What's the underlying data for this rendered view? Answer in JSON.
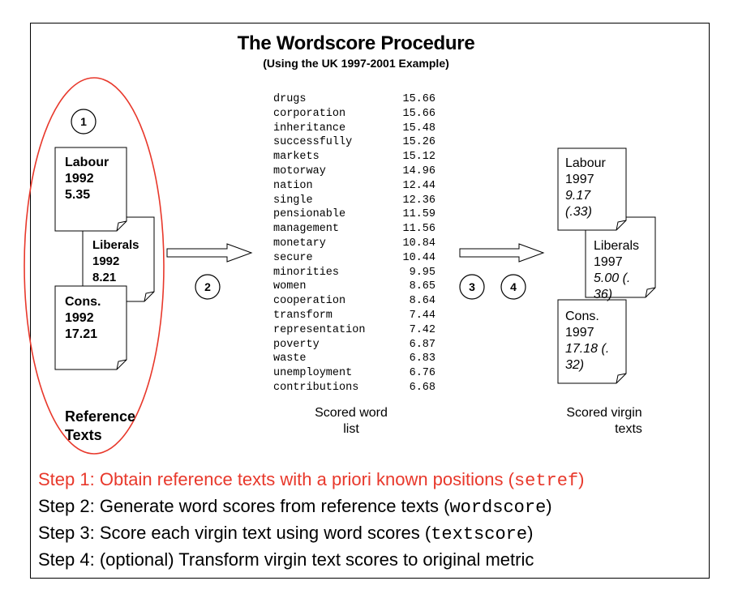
{
  "title": "The Wordscore Procedure",
  "subtitle": "(Using the UK 1997-2001 Example)",
  "reference": {
    "labour": {
      "name": "Labour",
      "year": "1992",
      "score": "5.35"
    },
    "liberals": {
      "name": "Liberals",
      "year": "1992",
      "score": "8.21"
    },
    "cons": {
      "name": "Cons.",
      "year": "1992",
      "score": "17.21"
    },
    "caption_line1": "Reference",
    "caption_line2": "Texts"
  },
  "word_list": [
    {
      "word": "drugs",
      "score": "15.66"
    },
    {
      "word": "corporation",
      "score": "15.66"
    },
    {
      "word": "inheritance",
      "score": "15.48"
    },
    {
      "word": "successfully",
      "score": "15.26"
    },
    {
      "word": "markets",
      "score": "15.12"
    },
    {
      "word": "motorway",
      "score": "14.96"
    },
    {
      "word": "nation",
      "score": "12.44"
    },
    {
      "word": "single",
      "score": "12.36"
    },
    {
      "word": "pensionable",
      "score": "11.59"
    },
    {
      "word": "management",
      "score": "11.56"
    },
    {
      "word": "monetary",
      "score": "10.84"
    },
    {
      "word": "secure",
      "score": "10.44"
    },
    {
      "word": "minorities",
      "score": "9.95"
    },
    {
      "word": "women",
      "score": "8.65"
    },
    {
      "word": "cooperation",
      "score": "8.64"
    },
    {
      "word": "transform",
      "score": "7.44"
    },
    {
      "word": "representation",
      "score": "7.42"
    },
    {
      "word": "poverty",
      "score": "6.87"
    },
    {
      "word": "waste",
      "score": "6.83"
    },
    {
      "word": "unemployment",
      "score": "6.76"
    },
    {
      "word": "contributions",
      "score": "6.68"
    }
  ],
  "word_list_caption_line1": "Scored word",
  "word_list_caption_line2": "list",
  "virgin": {
    "labour": {
      "name": "Labour",
      "year": "1997",
      "score_line1": "9.17",
      "score_line2": "(.33)"
    },
    "liberals": {
      "name": "Liberals",
      "year": "1997",
      "score_line1": "5.00 (.",
      "score_line2": "36)"
    },
    "cons": {
      "name": "Cons.",
      "year": "1997",
      "score_line1": "17.18 (.",
      "score_line2": "32)"
    },
    "caption_line1": "Scored virgin",
    "caption_line2": "texts"
  },
  "step_numbers": [
    "1",
    "2",
    "3",
    "4"
  ],
  "steps": [
    {
      "text": "Step 1: Obtain reference texts with a priori known positions (",
      "code": "setref",
      "end": ")"
    },
    {
      "text": "Step 2: Generate word scores from reference texts (",
      "code": "wordscore",
      "end": ")"
    },
    {
      "text": "Step 3: Score each virgin text using word scores (",
      "code": "textscore",
      "end": ")"
    },
    {
      "text": "Step 4: (optional) Transform virgin text scores to original metric",
      "code": "",
      "end": ""
    }
  ],
  "colors": {
    "highlight": "#e8382b",
    "ink": "#000000"
  }
}
